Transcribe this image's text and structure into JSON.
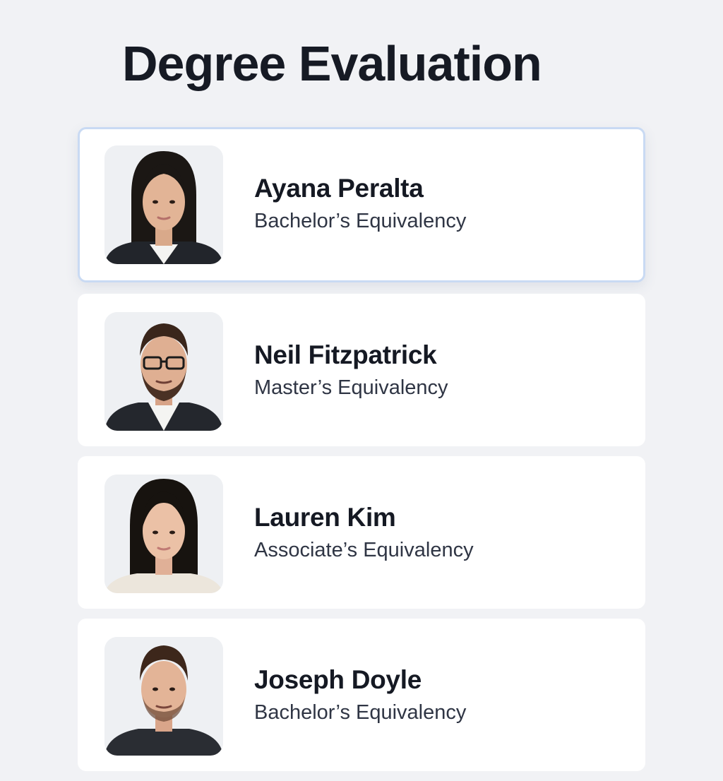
{
  "page": {
    "title": "Degree Evaluation"
  },
  "colors": {
    "background": "#f1f2f5",
    "card": "#ffffff",
    "selected_border": "#c9daf3",
    "title_text": "#161a24",
    "secondary_text": "#2f3544"
  },
  "evaluations": [
    {
      "name": "Ayana Peralta",
      "degree": "Bachelor’s Equivalency",
      "selected": true,
      "avatar": "woman-long-black-hair-photo"
    },
    {
      "name": "Neil Fitzpatrick",
      "degree": "Master’s Equivalency",
      "selected": false,
      "avatar": "man-glasses-beard-photo"
    },
    {
      "name": "Lauren Kim",
      "degree": "Associate’s Equivalency",
      "selected": false,
      "avatar": "woman-long-black-hair-photo"
    },
    {
      "name": "Joseph Doyle",
      "degree": "Bachelor’s Equivalency",
      "selected": false,
      "avatar": "man-short-hair-photo"
    }
  ]
}
